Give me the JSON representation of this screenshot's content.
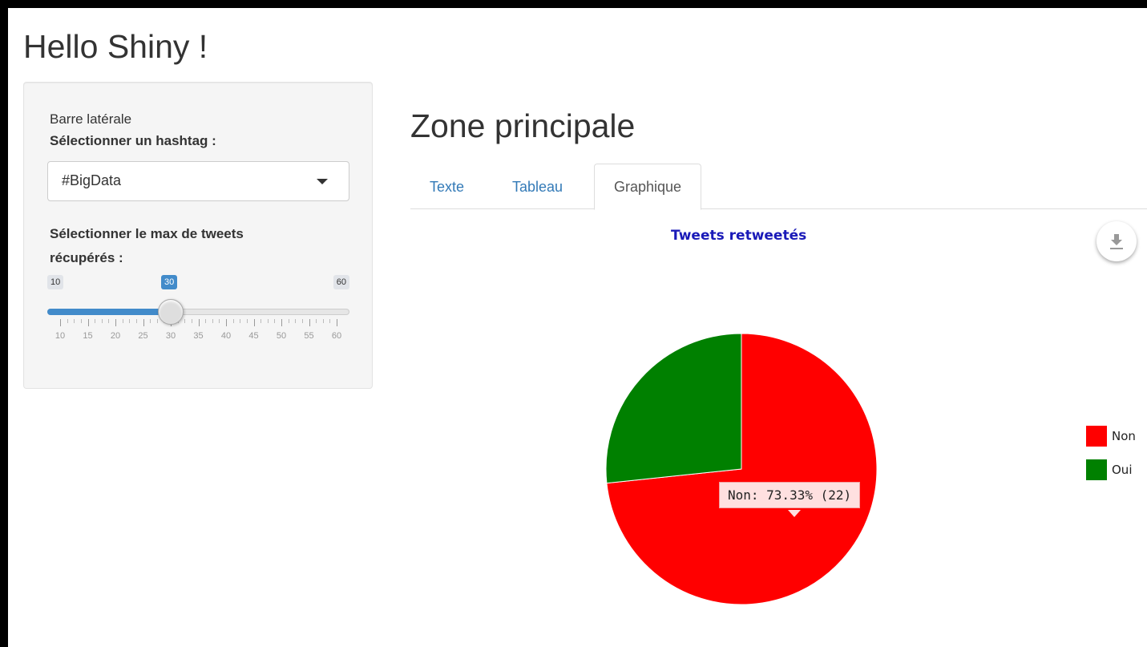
{
  "app": {
    "title": "Hello Shiny !"
  },
  "sidebar": {
    "caption": "Barre latérale",
    "hashtag_label": "Sélectionner un hashtag :",
    "hashtag_value": "#BigData",
    "max_label_line1": "Sélectionner le max de tweets",
    "max_label_line2": "récupérés :",
    "slider": {
      "min": 10,
      "max": 60,
      "value": 30,
      "step": 5,
      "min_label": "10",
      "max_label": "60",
      "value_label": "30",
      "tick_labels": [
        "10",
        "15",
        "20",
        "25",
        "30",
        "35",
        "40",
        "45",
        "50",
        "55",
        "60"
      ]
    }
  },
  "main": {
    "title": "Zone principale",
    "tabs": [
      {
        "label": "Texte"
      },
      {
        "label": "Tableau"
      },
      {
        "label": "Graphique"
      }
    ],
    "active_tab": "Graphique",
    "tooltip": "Non: 73.33% (22)"
  },
  "icons": {
    "dropdown": "caret-down-icon",
    "download": "download-icon"
  },
  "chart_data": {
    "type": "pie",
    "title": "Tweets retweetés",
    "categories": [
      "Non",
      "Oui"
    ],
    "values": [
      22,
      8
    ],
    "percentages": [
      73.33,
      26.67
    ],
    "colors": [
      "#ff0000",
      "#008000"
    ],
    "legend_position": "right"
  }
}
